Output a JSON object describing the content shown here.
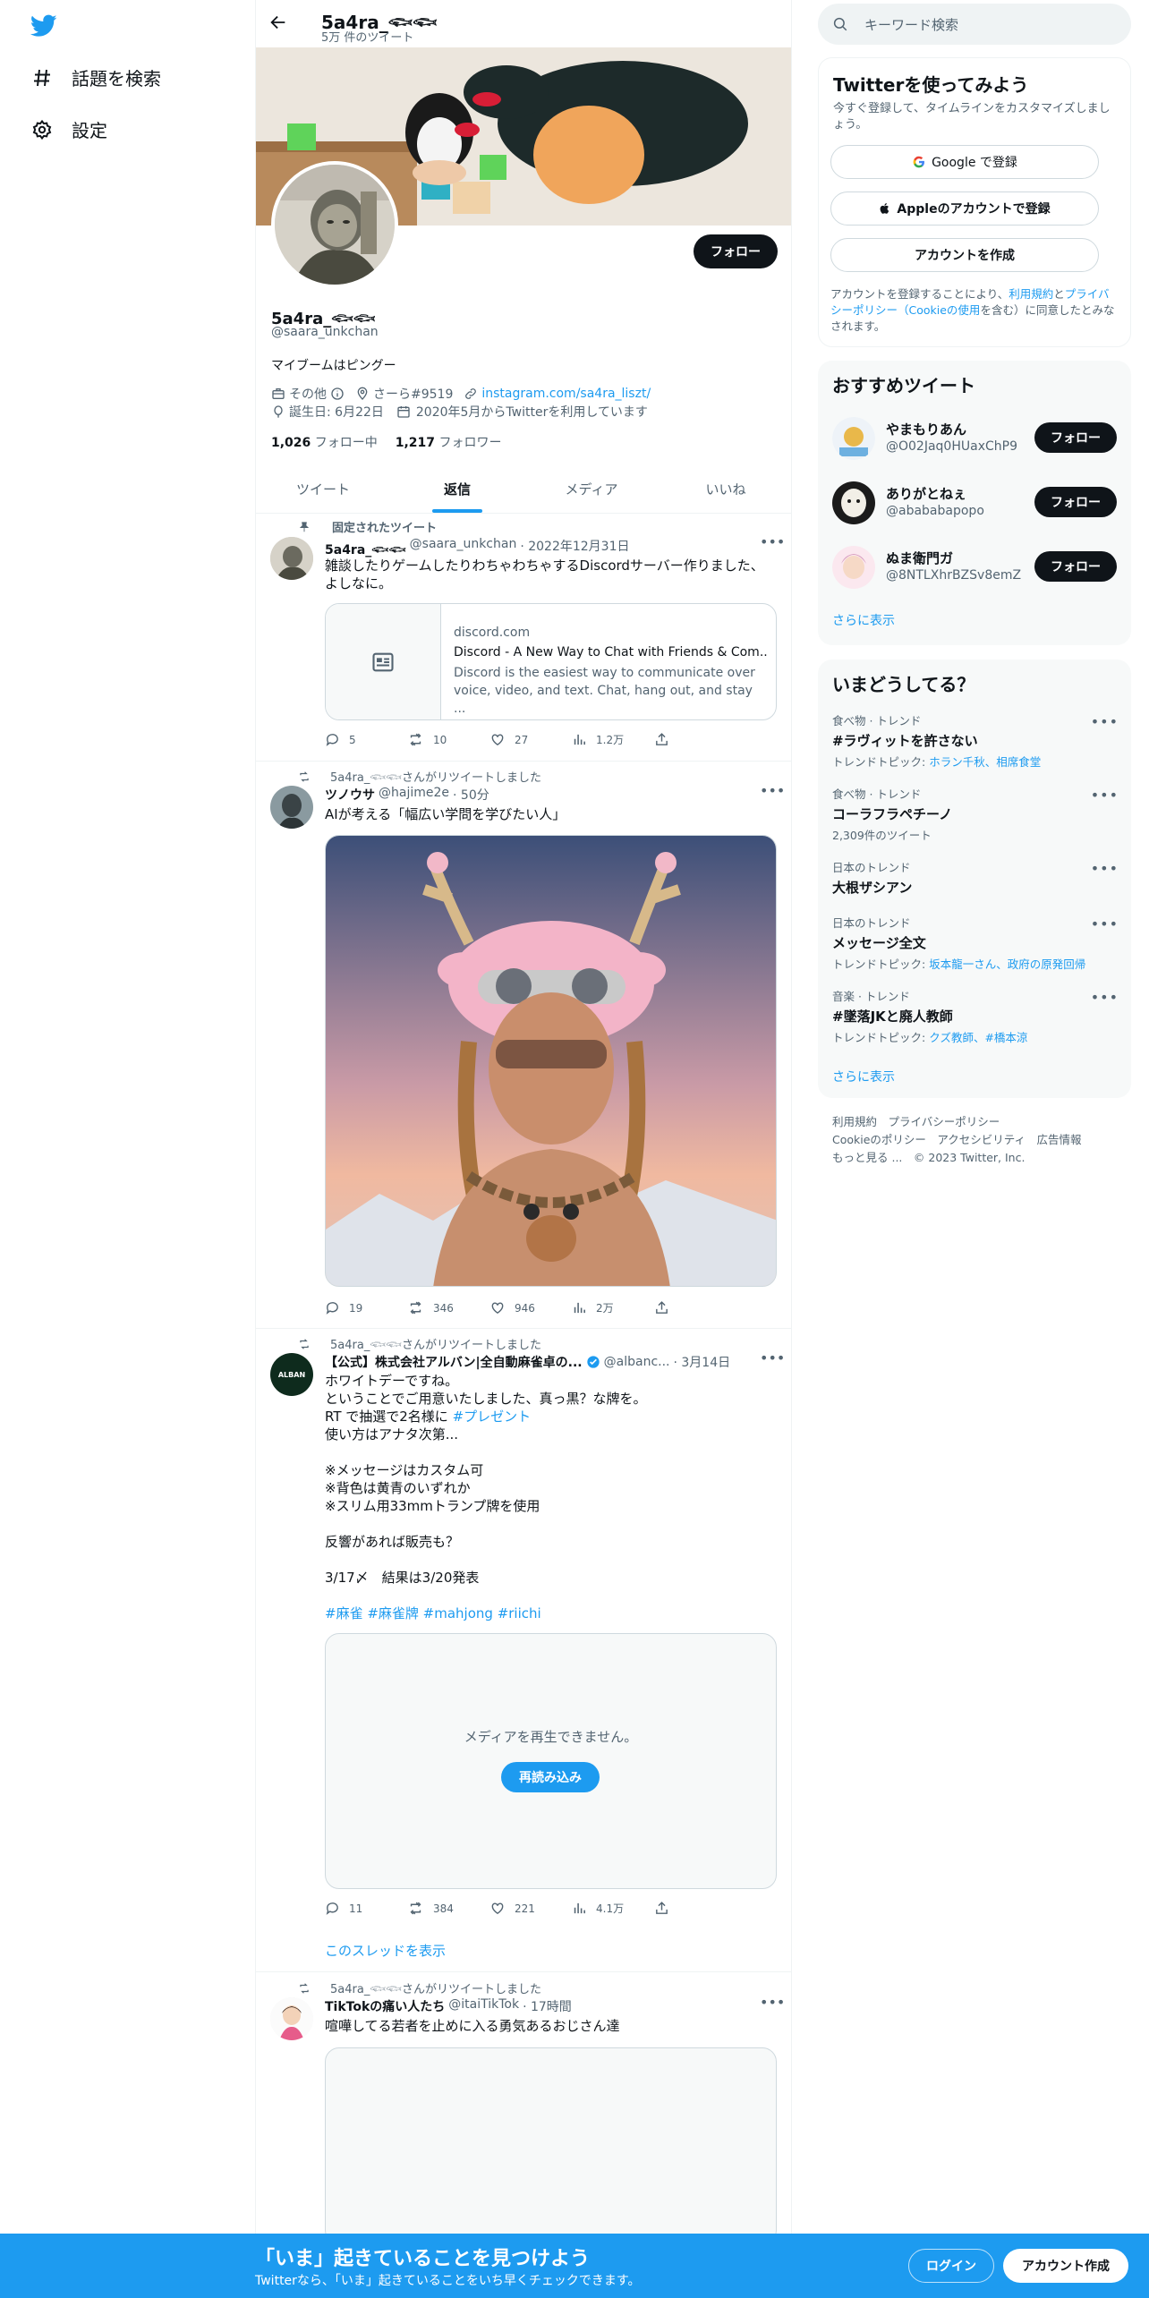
{
  "nav": {
    "explore_label": "話題を検索",
    "settings_label": "設定"
  },
  "profile": {
    "header_name": "5a4ra_𓆟𓆟",
    "header_count": "5万 件のツイート",
    "name": "5a4ra_𓆟𓆟",
    "handle": "@saara_unkchan",
    "bio": "マイブームはピングー",
    "category": "その他",
    "location": "さーら#9519",
    "website": "instagram.com/sa4ra_liszt/",
    "birthday": "誕生日: 6月22日",
    "joined": "2020年5月からTwitterを利用しています",
    "following_count": "1,026",
    "following_label": "フォロー中",
    "followers_count": "1,217",
    "followers_label": "フォロワー",
    "follow_button": "フォロー"
  },
  "tabs": [
    {
      "label": "ツイート"
    },
    {
      "label": "返信"
    },
    {
      "label": "メディア"
    },
    {
      "label": "いいね"
    }
  ],
  "tweets": [
    {
      "pinned_label": "固定されたツイート",
      "author": "5a4ra_𓆟𓆟",
      "handle": "@saara_unkchan",
      "time": "· 2022年12月31日",
      "text": "雑談したりゲームしたりわちゃわちゃするDiscordサーバー作りました、よしなに。",
      "card_domain": "discord.com",
      "card_title": "Discord - A New Way to Chat with Friends & Com...",
      "card_desc": "Discord is the easiest way to communicate over voice, video, and text. Chat, hang out, and stay ...",
      "replies": "5",
      "retweets": "10",
      "likes": "27",
      "views": "1.2万"
    },
    {
      "retweeted_label": "5a4ra_𓆟𓆟さんがリツイートしました",
      "author": "ツノウサ",
      "handle": "@hajime2e",
      "time": "· 50分",
      "text": "AIが考える「幅広い学問を学びたい人」",
      "replies": "19",
      "retweets": "346",
      "likes": "946",
      "views": "2万"
    },
    {
      "retweeted_label": "5a4ra_𓆟𓆟さんがリツイートしました",
      "author": "【公式】株式会社アルバン|全自動麻雀卓の...",
      "handle": "@albanc...",
      "time": "· 3月14日",
      "line1": "ホワイトデーですね。",
      "line2": "ということでご用意いたしました、真っ黒？な牌を。",
      "line3_pre": "RT で抽選で2名様に",
      "line3_tag": "#プレゼント",
      "line4": "使い方はアナタ次第...",
      "line5": "※メッセージはカスタム可",
      "line6": "※背色は黄青のいずれか",
      "line7": "※スリム用33mmトランプ牌を使用",
      "line8": "反響があれば販売も？",
      "line9": "3/17〆　結果は3/20発表",
      "hashtags": "#麻雀 #麻雀牌 #mahjong #riichi",
      "media_error": "メディアを再生できません。",
      "reload_button": "再読み込み",
      "replies": "11",
      "retweets": "384",
      "likes": "221",
      "views": "4.1万",
      "show_thread": "このスレッドを表示",
      "avatar_text": "ALBAN"
    },
    {
      "retweeted_label": "5a4ra_𓆟𓆟さんがリツイートしました",
      "author": "TikTokの痛い人たち",
      "handle": "@itaiTikTok",
      "time": "· 17時間",
      "text": "喧嘩してる若者を止めに入る勇気あるおじさん達"
    }
  ],
  "right": {
    "search_placeholder": "キーワード検索",
    "signup": {
      "title": "Twitterを使ってみよう",
      "subtitle": "今すぐ登録して、タイムラインをカスタマイズしましょう。",
      "google": "Google で登録",
      "apple": "Appleのアカウントで登録",
      "create": "アカウントを作成",
      "legal_pre": "アカウントを登録することにより、",
      "legal_terms": "利用規約",
      "legal_and": "と",
      "legal_privacy": "プライバシーポリシー（Cookieの使用",
      "legal_post": "を含む）に同意したとみなされます。"
    },
    "recommend": {
      "title": "おすすめツイート",
      "users": [
        {
          "name": "やまもりあん",
          "handle": "@O02Jaq0HUaxChP9",
          "button": "フォロー"
        },
        {
          "name": "ありがとねぇ",
          "handle": "@abababapopo",
          "button": "フォロー"
        },
        {
          "name": "ぬま衛門ガ",
          "handle": "@8NTLXhrBZSv8emZ",
          "button": "フォロー"
        }
      ],
      "more": "さらに表示"
    },
    "trends": {
      "title": "いまどうしてる？",
      "items": [
        {
          "context": "食べ物 · トレンド",
          "name": "#ラヴィットを許さない",
          "meta_pre": "トレンドトピック: ",
          "meta_links": "ホラン千秋、相席食堂"
        },
        {
          "context": "食べ物 · トレンド",
          "name": "コーラフラペチーノ",
          "meta_pre": "2,309件のツイート",
          "meta_links": ""
        },
        {
          "context": "日本のトレンド",
          "name": "大根ザシアン",
          "meta_pre": "",
          "meta_links": ""
        },
        {
          "context": "日本のトレンド",
          "name": "メッセージ全文",
          "meta_pre": "トレンドトピック: ",
          "meta_links": "坂本龍一さん、政府の原発回帰"
        },
        {
          "context": "音楽 · トレンド",
          "name": "#墜落JKと廃人教師",
          "meta_pre": "トレンドトピック: ",
          "meta_links": "クズ教師、#橋本涼"
        }
      ],
      "more": "さらに表示"
    },
    "footer": {
      "line1": "利用規約　プライバシーポリシー",
      "line2": "Cookieのポリシー　アクセシビリティ　広告情報",
      "line3": "もっと見る ...　© 2023 Twitter, Inc."
    }
  },
  "bottom": {
    "headline": "「いま」起きていることを見つけよう",
    "sub": "Twitterなら、「いま」起きていることをいち早くチェックできます。",
    "login": "ログイン",
    "signup": "アカウント作成"
  },
  "colors": {
    "accent": "#1d9bf0",
    "text": "#0f1419",
    "muted": "#536471"
  }
}
